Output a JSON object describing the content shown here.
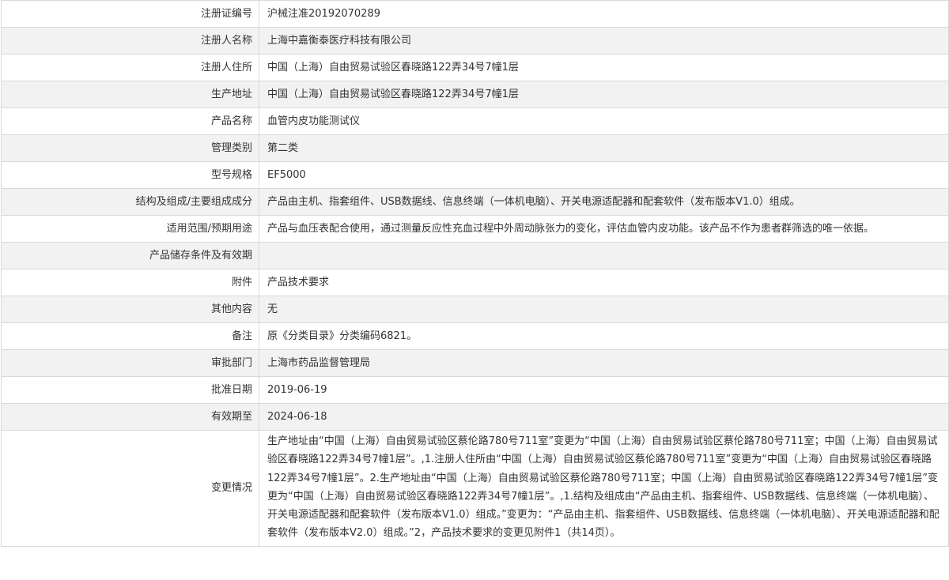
{
  "rows": [
    {
      "label": "注册证编号",
      "value": "沪械注准20192070289"
    },
    {
      "label": "注册人名称",
      "value": "上海中嘉衡泰医疗科技有限公司"
    },
    {
      "label": "注册人住所",
      "value": "中国（上海）自由贸易试验区春晓路122弄34号7幢1层"
    },
    {
      "label": "生产地址",
      "value": "中国（上海）自由贸易试验区春晓路122弄34号7幢1层"
    },
    {
      "label": "产品名称",
      "value": "血管内皮功能测试仪"
    },
    {
      "label": "管理类别",
      "value": "第二类"
    },
    {
      "label": "型号规格",
      "value": "EF5000"
    },
    {
      "label": "结构及组成/主要组成成分",
      "value": "产品由主机、指套组件、USB数据线、信息终端（一体机电脑）、开关电源适配器和配套软件（发布版本V1.0）组成。"
    },
    {
      "label": "适用范围/预期用途",
      "value": "产品与血压表配合使用，通过测量反应性充血过程中外周动脉张力的变化，评估血管内皮功能。该产品不作为患者群筛选的唯一依据。"
    },
    {
      "label": "产品储存条件及有效期",
      "value": ""
    },
    {
      "label": "附件",
      "value": "产品技术要求"
    },
    {
      "label": "其他内容",
      "value": "无"
    },
    {
      "label": "备注",
      "value": "原《分类目录》分类编码6821。"
    },
    {
      "label": "审批部门",
      "value": "上海市药品监督管理局"
    },
    {
      "label": "批准日期",
      "value": "2019-06-19"
    },
    {
      "label": "有效期至",
      "value": "2024-06-18"
    },
    {
      "label": "变更情况",
      "value": "生产地址由“中国（上海）自由贸易试验区蔡伦路780号711室”变更为“中国（上海）自由贸易试验区蔡伦路780号711室；中国（上海）自由贸易试验区春晓路122弄34号7幢1层”。,1.注册人住所由“中国（上海）自由贸易试验区蔡伦路780号711室”变更为“中国（上海）自由贸易试验区春晓路122弄34号7幢1层”。2.生产地址由“中国（上海）自由贸易试验区蔡伦路780号711室；中国（上海）自由贸易试验区春晓路122弄34号7幢1层”变更为“中国（上海）自由贸易试验区春晓路122弄34号7幢1层”。,1.结构及组成由“产品由主机、指套组件、USB数据线、信息终端（一体机电脑）、开关电源适配器和配套软件（发布版本V1.0）组成。”变更为：“产品由主机、指套组件、USB数据线、信息终端（一体机电脑）、开关电源适配器和配套软件（发布版本V2.0）组成。”2，产品技术要求的变更见附件1（共14页）。"
    }
  ]
}
